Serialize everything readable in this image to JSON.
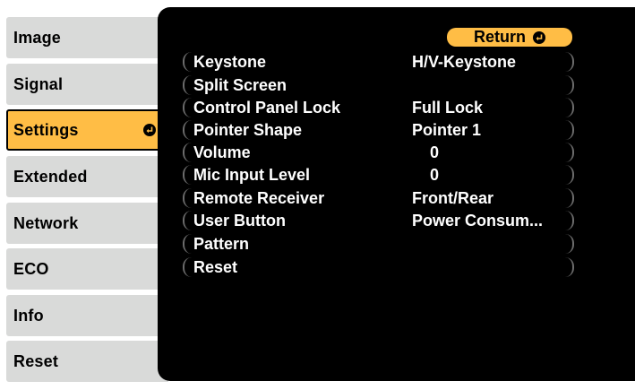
{
  "menu": {
    "items": [
      {
        "label": "Image"
      },
      {
        "label": "Signal"
      },
      {
        "label": "Settings"
      },
      {
        "label": "Extended"
      },
      {
        "label": "Network"
      },
      {
        "label": "ECO"
      },
      {
        "label": "Info"
      },
      {
        "label": "Reset"
      }
    ],
    "selected": "Settings"
  },
  "panel": {
    "return_label": "Return",
    "rows": [
      {
        "label": "Keystone",
        "value": "H/V-Keystone"
      },
      {
        "label": "Split Screen",
        "value": ""
      },
      {
        "label": "Control Panel Lock",
        "value": "Full Lock"
      },
      {
        "label": "Pointer Shape",
        "value": "Pointer 1"
      },
      {
        "label": "Volume",
        "value": "0"
      },
      {
        "label": "Mic Input Level",
        "value": "0"
      },
      {
        "label": "Remote Receiver",
        "value": "Front/Rear"
      },
      {
        "label": "User Button",
        "value": "Power Consum..."
      },
      {
        "label": "Pattern",
        "value": ""
      },
      {
        "label": "Reset",
        "value": ""
      }
    ]
  },
  "colors": {
    "highlight": "#ffbd45",
    "menu_bg": "#d9dad9",
    "panel_bg": "#000000",
    "text_light": "#ffffff"
  }
}
